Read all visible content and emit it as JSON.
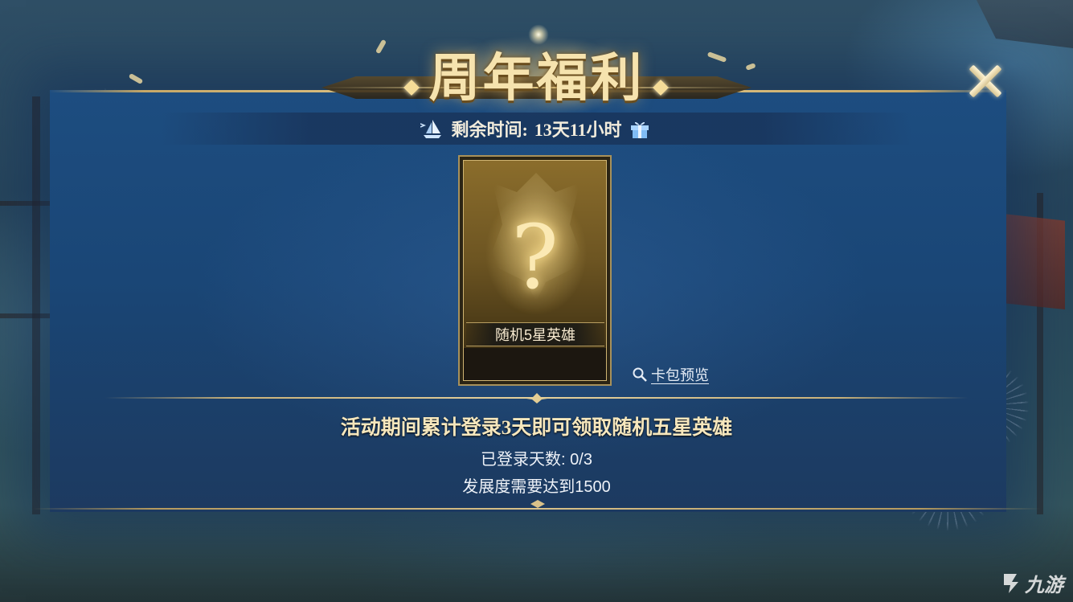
{
  "header": {
    "title": "周年福利",
    "close_icon": "close-icon"
  },
  "timer": {
    "label": "剩余时间:",
    "value": "13天11小时",
    "left_icon": "sailboat-icon",
    "right_icon": "gift-icon"
  },
  "reward_card": {
    "symbol": "?",
    "name": "随机5星英雄"
  },
  "preview": {
    "label": "卡包预览",
    "icon": "search-icon"
  },
  "task": {
    "description": "活动期间累计登录3天即可领取随机五星英雄",
    "login_days_label": "已登录天数:",
    "login_days_value": "0/3",
    "requirement": "发展度需要达到1500"
  },
  "watermark": {
    "text": "九游"
  },
  "colors": {
    "panel_blue": "#1a4676",
    "gold_accent": "#e6cf93",
    "title_gold": "#f6e3ae",
    "task_text": "#f6e7bd"
  }
}
